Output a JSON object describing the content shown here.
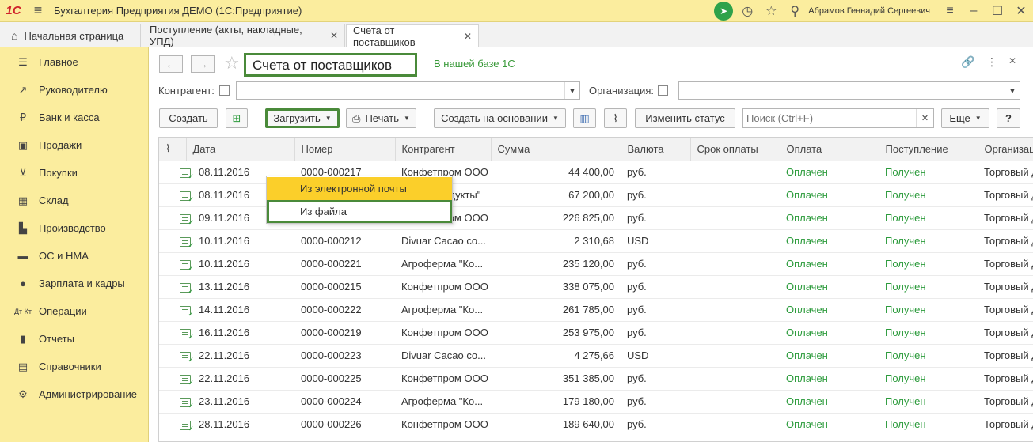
{
  "titlebar": {
    "logo": "1С",
    "app_title": "Бухгалтерия Предприятия ДЕМО  (1С:Предприятие)",
    "user": "Абрамов Геннадий Сергеевич"
  },
  "tabs": [
    {
      "label": "Начальная страница"
    },
    {
      "label": "Поступление (акты, накладные, УПД)"
    },
    {
      "label": "Счета от поставщиков"
    }
  ],
  "sidebar": {
    "items": [
      {
        "label": "Главное",
        "icon": "menu-icon"
      },
      {
        "label": "Руководителю",
        "icon": "chart-icon"
      },
      {
        "label": "Банк и касса",
        "icon": "ruble-icon"
      },
      {
        "label": "Продажи",
        "icon": "bag-icon"
      },
      {
        "label": "Покупки",
        "icon": "cart-icon"
      },
      {
        "label": "Склад",
        "icon": "warehouse-icon"
      },
      {
        "label": "Производство",
        "icon": "factory-icon"
      },
      {
        "label": "ОС и НМА",
        "icon": "truck-icon"
      },
      {
        "label": "Зарплата и кадры",
        "icon": "person-icon"
      },
      {
        "label": "Операции",
        "icon": "dt-kt-icon"
      },
      {
        "label": "Отчеты",
        "icon": "bar-chart-icon"
      },
      {
        "label": "Справочники",
        "icon": "books-icon"
      },
      {
        "label": "Администрирование",
        "icon": "gear-icon"
      }
    ]
  },
  "form": {
    "title": "Счета от поставщиков",
    "in_base": "В нашей базе 1С",
    "filters": {
      "counterparty_label": "Контрагент:",
      "organization_label": "Организация:"
    }
  },
  "toolbar": {
    "create": "Создать",
    "load": "Загрузить",
    "print": "Печать",
    "create_based": "Создать на основании",
    "change_status": "Изменить статус",
    "search_placeholder": "Поиск (Ctrl+F)",
    "more": "Еще",
    "help": "?"
  },
  "dropdown": {
    "items": [
      "Из электронной почты",
      "Из файла"
    ]
  },
  "table": {
    "columns": [
      "Дата",
      "Номер",
      "Контрагент",
      "Сумма",
      "Валюта",
      "Срок оплаты",
      "Оплата",
      "Поступление",
      "Организация"
    ],
    "rows": [
      {
        "date": "08.11.2016",
        "number": "0000-000217",
        "counterparty": "Конфетпром ООО",
        "sum": "44 400,00",
        "currency": "руб.",
        "due": "",
        "payment": "Оплачен",
        "receipt": "Получен",
        "org": "Торговый дом"
      },
      {
        "date": "08.11.2016",
        "number": "0000-000220",
        "counterparty": "База \"Продукты\"",
        "sum": "67 200,00",
        "currency": "руб.",
        "due": "",
        "payment": "Оплачен",
        "receipt": "Получен",
        "org": "Торговый дом"
      },
      {
        "date": "09.11.2016",
        "number": "0000-000211",
        "counterparty": "Конфетпром ООО",
        "sum": "226 825,00",
        "currency": "руб.",
        "due": "",
        "payment": "Оплачен",
        "receipt": "Получен",
        "org": "Торговый дом"
      },
      {
        "date": "10.11.2016",
        "number": "0000-000212",
        "counterparty": "Divuar Cacao co...",
        "sum": "2 310,68",
        "currency": "USD",
        "due": "",
        "payment": "Оплачен",
        "receipt": "Получен",
        "org": "Торговый дом"
      },
      {
        "date": "10.11.2016",
        "number": "0000-000221",
        "counterparty": "Агроферма \"Ко...",
        "sum": "235 120,00",
        "currency": "руб.",
        "due": "",
        "payment": "Оплачен",
        "receipt": "Получен",
        "org": "Торговый дом"
      },
      {
        "date": "13.11.2016",
        "number": "0000-000215",
        "counterparty": "Конфетпром ООО",
        "sum": "338 075,00",
        "currency": "руб.",
        "due": "",
        "payment": "Оплачен",
        "receipt": "Получен",
        "org": "Торговый дом"
      },
      {
        "date": "14.11.2016",
        "number": "0000-000222",
        "counterparty": "Агроферма \"Ко...",
        "sum": "261 785,00",
        "currency": "руб.",
        "due": "",
        "payment": "Оплачен",
        "receipt": "Получен",
        "org": "Торговый дом"
      },
      {
        "date": "16.11.2016",
        "number": "0000-000219",
        "counterparty": "Конфетпром ООО",
        "sum": "253 975,00",
        "currency": "руб.",
        "due": "",
        "payment": "Оплачен",
        "receipt": "Получен",
        "org": "Торговый дом"
      },
      {
        "date": "22.11.2016",
        "number": "0000-000223",
        "counterparty": "Divuar Cacao co...",
        "sum": "4 275,66",
        "currency": "USD",
        "due": "",
        "payment": "Оплачен",
        "receipt": "Получен",
        "org": "Торговый дом"
      },
      {
        "date": "22.11.2016",
        "number": "0000-000225",
        "counterparty": "Конфетпром ООО",
        "sum": "351 385,00",
        "currency": "руб.",
        "due": "",
        "payment": "Оплачен",
        "receipt": "Получен",
        "org": "Торговый дом"
      },
      {
        "date": "23.11.2016",
        "number": "0000-000224",
        "counterparty": "Агроферма \"Ко...",
        "sum": "179 180,00",
        "currency": "руб.",
        "due": "",
        "payment": "Оплачен",
        "receipt": "Получен",
        "org": "Торговый дом"
      },
      {
        "date": "28.11.2016",
        "number": "0000-000226",
        "counterparty": "Конфетпром ООО",
        "sum": "189 640,00",
        "currency": "руб.",
        "due": "",
        "payment": "Оплачен",
        "receipt": "Получен",
        "org": "Торговый дом"
      }
    ]
  },
  "colors": {
    "accent_yellow": "#fbed9e",
    "highlight_yellow": "#fbcf2a",
    "status_green": "#2a9a3a",
    "frame_green": "#4a8a3a"
  }
}
